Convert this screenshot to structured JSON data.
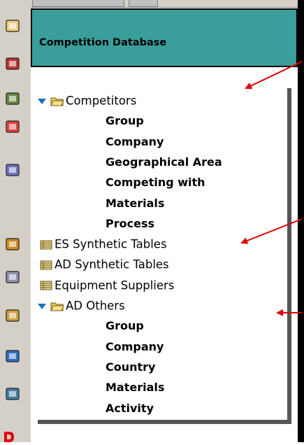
{
  "header": {
    "title": "Competition Database"
  },
  "tree": [
    {
      "label": "Competitors",
      "type": "folder",
      "expanded": true,
      "children": [
        "Group",
        "Company",
        "Geographical Area",
        "Competing with",
        "Materials",
        "Process"
      ]
    },
    {
      "label": "ES Synthetic Tables",
      "type": "table"
    },
    {
      "label": "AD Synthetic Tables",
      "type": "table"
    },
    {
      "label": "Equipment Suppliers",
      "type": "table"
    },
    {
      "label": "AD Others",
      "type": "folder",
      "expanded": true,
      "children": [
        "Group",
        "Company",
        "Country",
        "Materials",
        "Activity"
      ]
    }
  ],
  "toolbar_icons": [
    "envelope-icon",
    "calendar-icon",
    "phone-book-icon",
    "checklist-icon",
    "cards-icon",
    "star-folder-icon",
    "files-icon",
    "folder-icon",
    "blue-folder-icon",
    "globe-folder-icon"
  ],
  "colors": {
    "header_bg": "#3a9e9a",
    "arrow": "#e00000",
    "expander": "#1d6fb5",
    "folder": "#e8c860"
  }
}
